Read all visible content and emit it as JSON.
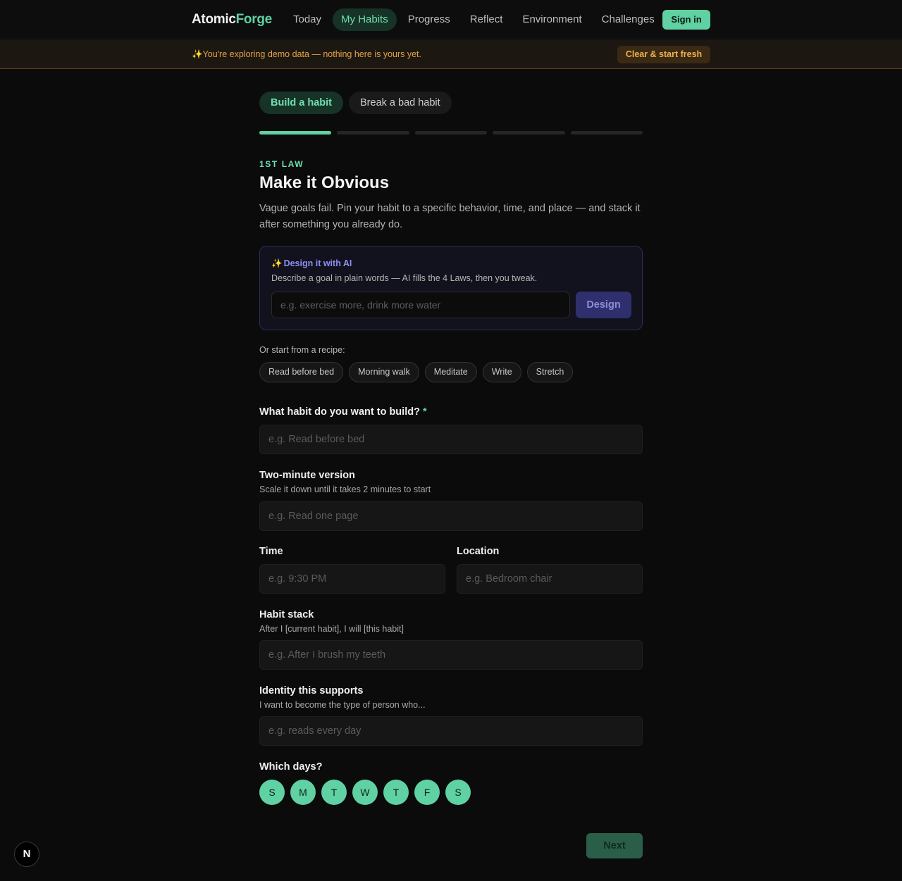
{
  "brand": {
    "part1": "Atomic",
    "part2": "Forge"
  },
  "nav": {
    "items": [
      {
        "label": "Today"
      },
      {
        "label": "My Habits",
        "active": true
      },
      {
        "label": "Progress"
      },
      {
        "label": "Reflect"
      },
      {
        "label": "Environment"
      },
      {
        "label": "Challenges"
      }
    ],
    "signin_label": "Sign in"
  },
  "banner": {
    "text": "✨You're exploring demo data — nothing here is yours yet.",
    "button_label": "Clear & start fresh"
  },
  "mode_tabs": [
    {
      "label": "Build a habit",
      "active": true
    },
    {
      "label": "Break a bad habit"
    }
  ],
  "wizard_progress": {
    "current_step": 1,
    "total_steps": 5
  },
  "step": {
    "eyebrow": "1ST LAW",
    "title": "Make it Obvious",
    "description": "Vague goals fail. Pin your habit to a specific behavior, time, and place — and stack it after something you already do."
  },
  "ai": {
    "spark": "✨",
    "title": "Design it with AI",
    "subtitle": "Describe a goal in plain words — AI fills the 4 Laws, then you tweak.",
    "placeholder": "e.g. exercise more, drink more water",
    "button_label": "Design"
  },
  "recipes": {
    "label": "Or start from a recipe:",
    "items": [
      "Read before bed",
      "Morning walk",
      "Meditate",
      "Write",
      "Stretch"
    ]
  },
  "fields": {
    "habit": {
      "label": "What habit do you want to build?",
      "required_mark": "*",
      "placeholder": "e.g. Read before bed"
    },
    "two_minute": {
      "label": "Two-minute version",
      "hint": "Scale it down until it takes 2 minutes to start",
      "placeholder": "e.g. Read one page"
    },
    "time": {
      "label": "Time",
      "placeholder": "e.g. 9:30 PM"
    },
    "location": {
      "label": "Location",
      "placeholder": "e.g. Bedroom chair"
    },
    "stack": {
      "label": "Habit stack",
      "hint": "After I [current habit], I will [this habit]",
      "placeholder": "e.g. After I brush my teeth"
    },
    "identity": {
      "label": "Identity this supports",
      "hint": "I want to become the type of person who...",
      "placeholder": "e.g. reads every day"
    }
  },
  "days": {
    "label": "Which days?",
    "items": [
      "S",
      "M",
      "T",
      "W",
      "T",
      "F",
      "S"
    ]
  },
  "next_label": "Next",
  "n_badge": "N",
  "colors": {
    "accent": "#5fd1a3",
    "ai_accent": "#8f8ff5",
    "banner_text": "#e0a44a",
    "background": "#0b0b0b"
  }
}
